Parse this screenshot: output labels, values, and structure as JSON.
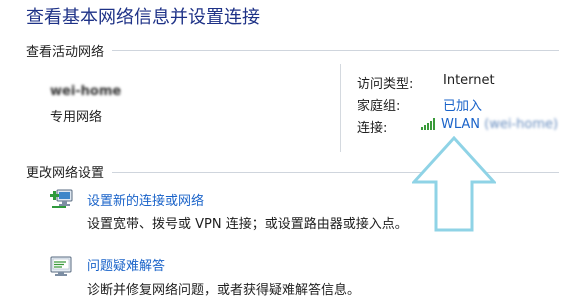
{
  "page": {
    "title": "查看基本网络信息并设置连接"
  },
  "active_networks": {
    "header": "查看活动网络",
    "network": {
      "name": "wei-home",
      "category": "专用网络"
    },
    "properties": {
      "access_type_label": "访问类型:",
      "access_type_value": "Internet",
      "homegroup_label": "家庭组:",
      "homegroup_value": "已加入",
      "connections_label": "连接:",
      "connection_name": "WLAN",
      "connection_ssid": "(wei-home)"
    }
  },
  "change_settings": {
    "header": "更改网络设置",
    "tasks": [
      {
        "icon": "new-connection-icon",
        "title": "设置新的连接或网络",
        "description": "设置宽带、拨号或 VPN 连接；或设置路由器或接入点。"
      },
      {
        "icon": "troubleshoot-icon",
        "title": "问题疑难解答",
        "description": "诊断并修复网络问题，或者获得疑难解答信息。"
      }
    ]
  },
  "colors": {
    "title": "#1e3287",
    "link": "#1a63c9",
    "annotation_arrow": "#8fd3e6"
  },
  "annotation": {
    "icon": "up-arrow-icon"
  }
}
